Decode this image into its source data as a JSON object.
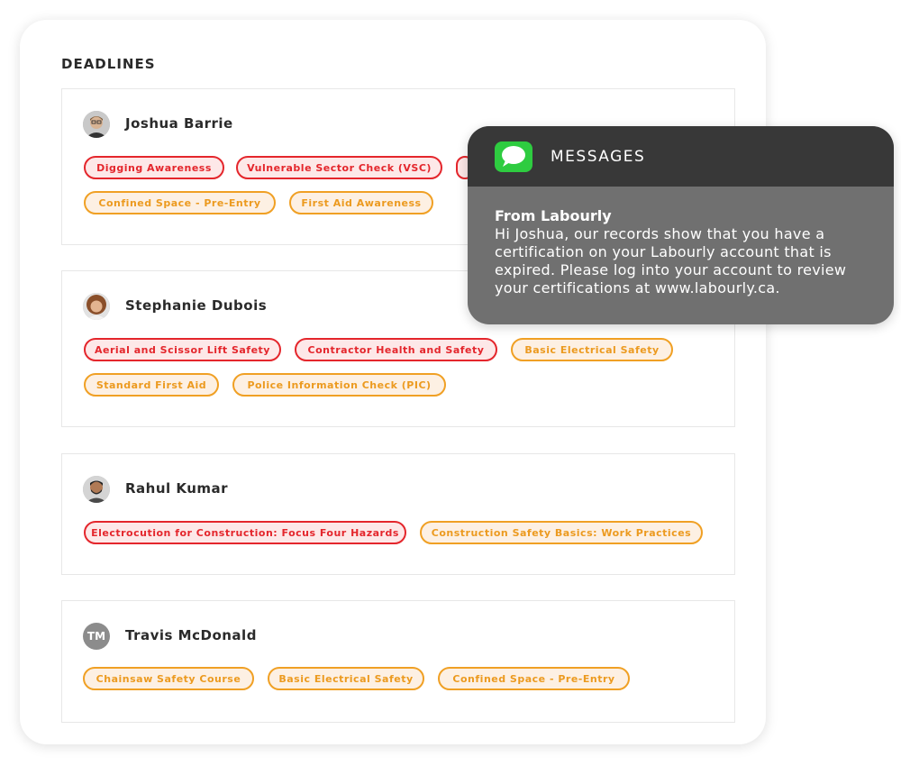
{
  "panel": {
    "title": "DEADLINES"
  },
  "people": [
    {
      "name": "Joshua Barrie",
      "tags": [
        {
          "label": "Digging Awareness",
          "status": "expired"
        },
        {
          "label": "Vulnerable Sector Check (VSC)",
          "status": "expired"
        },
        {
          "label": "",
          "status": "expired"
        },
        {
          "label": "Confined Space - Pre-Entry",
          "status": "expiring"
        },
        {
          "label": "First Aid Awareness",
          "status": "expiring"
        }
      ]
    },
    {
      "name": "Stephanie Dubois",
      "tags": [
        {
          "label": "Aerial and Scissor Lift Safety",
          "status": "expired"
        },
        {
          "label": "Contractor Health and Safety",
          "status": "expired"
        },
        {
          "label": "Basic Electrical Safety",
          "status": "expiring"
        },
        {
          "label": "Standard First Aid",
          "status": "expiring"
        },
        {
          "label": "Police Information Check (PIC)",
          "status": "expiring"
        }
      ]
    },
    {
      "name": "Rahul Kumar",
      "tags": [
        {
          "label": "Electrocution for Construction: Focus Four Hazards",
          "status": "expired"
        },
        {
          "label": "Construction Safety Basics:  Work Practices",
          "status": "expiring"
        }
      ]
    },
    {
      "name": "Travis McDonald",
      "initials": "TM",
      "tags": [
        {
          "label": "Chainsaw Safety Course",
          "status": "expiring"
        },
        {
          "label": "Basic Electrical Safety",
          "status": "expiring"
        },
        {
          "label": "Confined Space - Pre-Entry",
          "status": "expiring"
        }
      ]
    }
  ],
  "notification": {
    "app": "MESSAGES",
    "icon": "messages-icon",
    "from": "From Labourly",
    "body": "Hi Joshua, our records show that you have a certification on your Labourly account that is expired. Please log into your account to review your certifications at www.labourly.ca."
  },
  "colors": {
    "expired": "#e4262c",
    "expiring": "#f0a024",
    "notification_bg": "#707070",
    "notification_header": "#383838",
    "messages_green": "#2ecc40"
  }
}
